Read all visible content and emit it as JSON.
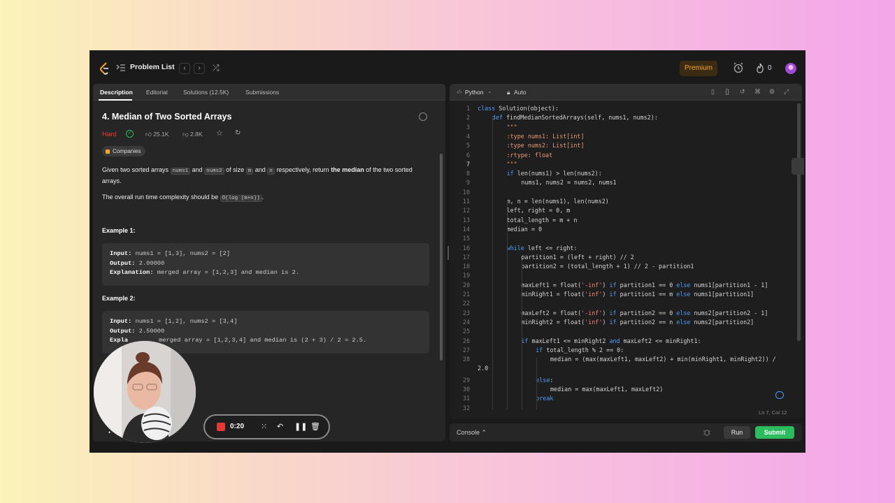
{
  "nav": {
    "problem_list": "Problem List",
    "premium": "Premium",
    "fire_count": "0",
    "prev": "‹",
    "next": "›"
  },
  "tabs": [
    "Description",
    "Editorial",
    "Solutions (12.5K)",
    "Submissions"
  ],
  "problem": {
    "title": "4. Median of Two Sorted Arrays",
    "difficulty": "Hard",
    "likes": "25.1K",
    "dislikes": "2.8K",
    "companies": "Companies",
    "desc_1": "Given two sorted arrays",
    "desc_nums1": "nums1",
    "desc_and": "and",
    "desc_nums2": "nums2",
    "desc_of_size": "of size",
    "desc_m": "m",
    "desc_and2": "and",
    "desc_n": "n",
    "desc_resp": "respectively, return",
    "desc_bold": "the median",
    "desc_end": "of the two sorted arrays.",
    "complexity_text": "The overall run time complexity should be",
    "complexity_code": "O(log (m+n))",
    "complexity_end": ".",
    "examples": [
      {
        "title": "Example 1:",
        "input_label": "Input:",
        "input": "nums1 = [1,3], nums2 = [2]",
        "output_label": "Output:",
        "output": "2.00000",
        "expl_label": "Explanation:",
        "expl": "merged array = [1,2,3] and median is 2."
      },
      {
        "title": "Example 2:",
        "input_label": "Input:",
        "input": "nums1 = [1,2], nums2 = [3,4]",
        "output_label": "Output:",
        "output": "2.50000",
        "expl_label": "Expla",
        "expl": "merged array = [1,2,3,4] and median is (2 + 3) / 2 = 2.5."
      }
    ]
  },
  "recorder": {
    "time": "0:20"
  },
  "editor": {
    "language": "Python",
    "mode": "Auto",
    "status": "Ln 7, Col 12",
    "active_line": 7
  },
  "console": {
    "label": "Console",
    "run": "Run",
    "submit": "Submit"
  },
  "colors": {
    "accent_green": "#2cbb5d",
    "hard_red": "#f63737",
    "premium_orange": "#f5a623",
    "keyword_blue": "#4f9bff"
  }
}
